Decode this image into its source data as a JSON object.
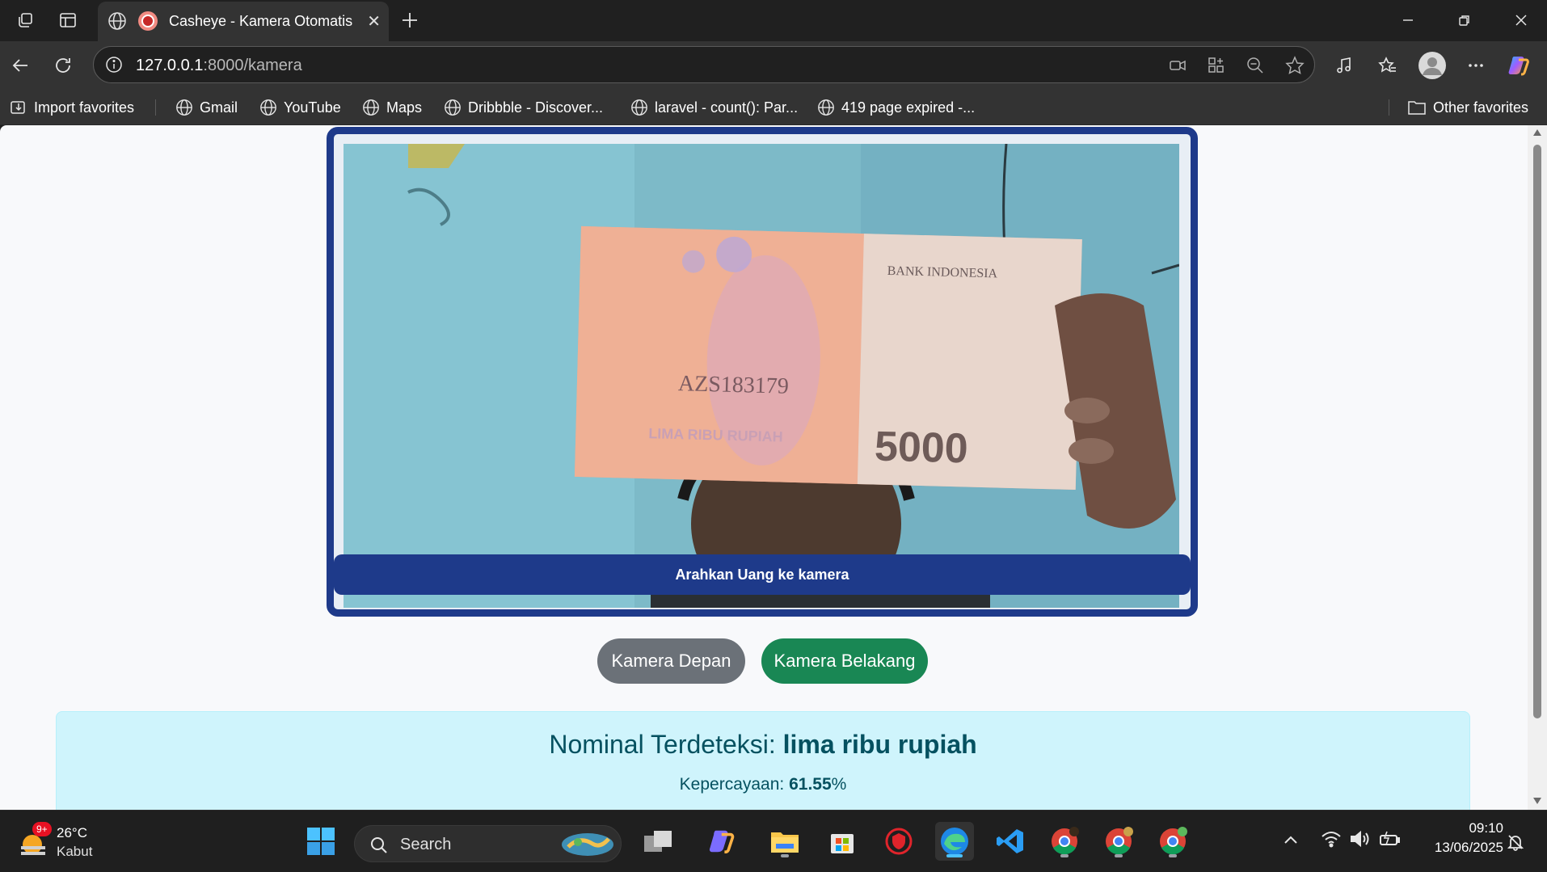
{
  "browser": {
    "tab_title": "Casheye - Kamera Otomatis",
    "url_host": "127.0.0.1",
    "url_path": ":8000/kamera",
    "bookmarks": [
      {
        "label": "Import favorites",
        "icon": "import-icon"
      },
      {
        "label": "Gmail",
        "icon": "globe-icon"
      },
      {
        "label": "YouTube",
        "icon": "globe-icon"
      },
      {
        "label": "Maps",
        "icon": "globe-icon"
      },
      {
        "label": "Dribbble - Discover...",
        "icon": "globe-icon"
      },
      {
        "label": "laravel - count(): Par...",
        "icon": "globe-icon"
      },
      {
        "label": "419 page expired -...",
        "icon": "globe-icon"
      }
    ],
    "other_favorites": "Other favorites"
  },
  "page": {
    "camera_hint": "Arahkan Uang ke kamera",
    "front_camera_label": "Kamera Depan",
    "back_camera_label": "Kamera Belakang",
    "result_label": "Nominal Terdeteksi:",
    "result_value": "lima ribu rupiah",
    "confidence_label": "Kepercayaan:",
    "confidence_value": "61.55",
    "confidence_unit": "%",
    "banknote": {
      "serial": "AZS183179",
      "bank_text": "BANK INDONESIA",
      "denomination": "5000",
      "words": "LIMA RIBU RUPIAH"
    }
  },
  "taskbar": {
    "weather_temp": "26°C",
    "weather_desc": "Kabut",
    "weather_badge": "9+",
    "search_placeholder": "Search",
    "time": "09:10",
    "date": "13/06/2025"
  },
  "colors": {
    "frame": "#1e3a8a",
    "btn_secondary": "#6b7178",
    "btn_success": "#198754",
    "alert_bg": "#cff4fc",
    "alert_text": "#055160"
  }
}
